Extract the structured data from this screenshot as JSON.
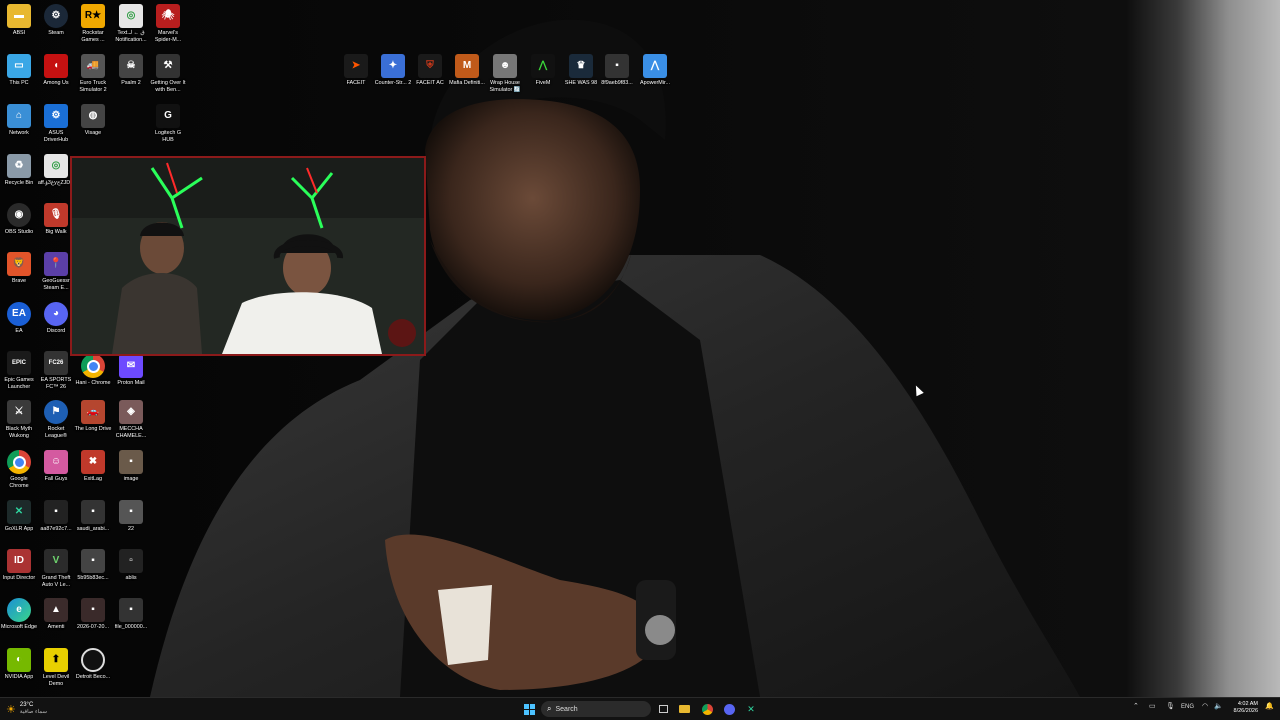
{
  "desktop_icons_col1": [
    {
      "label": "ABSI",
      "icon": "folder-icon",
      "color": "#e8b830"
    },
    {
      "label": "This PC",
      "icon": "monitor-icon",
      "color": "#3aa7e6"
    },
    {
      "label": "Network",
      "icon": "network-icon",
      "color": "#3a8fd6"
    },
    {
      "label": "Recycle Bin",
      "icon": "recycle-bin-icon",
      "color": "#8a9aa8"
    },
    {
      "label": "OBS Studio",
      "icon": "obs-icon",
      "color": "#2a2a2a"
    },
    {
      "label": "Brave",
      "icon": "brave-icon",
      "color": "#e2542a"
    },
    {
      "label": "EA",
      "icon": "ea-icon",
      "color": "#1a5fd6"
    },
    {
      "label": "Epic Games Launcher",
      "icon": "epic-games-icon",
      "color": "#1a1a1a"
    },
    {
      "label": "Black Myth Wukong",
      "icon": "black-myth-icon",
      "color": "#3a3a3a"
    },
    {
      "label": "Google Chrome",
      "icon": "chrome-icon",
      "color": "#2f9e44"
    },
    {
      "label": "GoXLR App",
      "icon": "goxlr-icon",
      "color": "#1d2a2a"
    },
    {
      "label": "Input Director",
      "icon": "input-director-icon",
      "color": "#a33"
    },
    {
      "label": "Microsoft Edge",
      "icon": "edge-icon",
      "color": "#1a8fd6"
    },
    {
      "label": "NVIDIA App",
      "icon": "nvidia-icon",
      "color": "#76b900"
    }
  ],
  "desktop_icons_col2": [
    {
      "label": "Steam",
      "icon": "steam-icon",
      "color": "#1b2838"
    },
    {
      "label": "Among Us",
      "icon": "among-us-icon",
      "color": "#c51111"
    },
    {
      "label": "ASUS DriverHub",
      "icon": "asus-icon",
      "color": "#1a6fd6"
    },
    {
      "label": "aff.غ3ؤyجZJDD",
      "icon": "chrome-shortcut-icon",
      "color": "#2f9e44"
    },
    {
      "label": "Big Walk",
      "icon": "big-walk-icon",
      "color": "#c0392b"
    },
    {
      "label": "GeoGuessr Steam E...",
      "icon": "geoguessr-icon",
      "color": "#5b3fa8"
    },
    {
      "label": "Discord",
      "icon": "discord-icon",
      "color": "#5865f2"
    },
    {
      "label": "EA SPORTS FC™ 26",
      "icon": "ea-fc-icon",
      "color": "#333"
    },
    {
      "label": "Rocket League®",
      "icon": "rocket-league-icon",
      "color": "#1e5fb4"
    },
    {
      "label": "Fall Guys",
      "icon": "fall-guys-icon",
      "color": "#d45aa0"
    },
    {
      "label": "aa87e92c7...",
      "icon": "image-file-icon",
      "color": "#222"
    },
    {
      "label": "Grand Theft Auto V Le...",
      "icon": "gta-icon",
      "color": "#2b2b2b"
    },
    {
      "label": "Amenti",
      "icon": "amenti-icon",
      "color": "#3b2b2b"
    },
    {
      "label": "Level Devil Demo",
      "icon": "level-devil-icon",
      "color": "#e8d000"
    }
  ],
  "desktop_icons_col3": [
    {
      "label": "Rockstar Games ...",
      "icon": "rockstar-icon",
      "color": "#f0a800"
    },
    {
      "label": "Euro Truck Simulator 2",
      "icon": "euro-truck-icon",
      "color": "#555"
    },
    {
      "label": "Visage",
      "icon": "visage-icon",
      "color": "#444"
    },
    {
      "label": "Hani - Chrome",
      "icon": "chrome-profile-icon",
      "color": "#2f9e44"
    },
    {
      "label": "The Long Drive",
      "icon": "long-drive-icon",
      "color": "#b5462f"
    },
    {
      "label": "ExitLag",
      "icon": "exitlag-icon",
      "color": "#c0392b"
    },
    {
      "label": "saudi_arabi...",
      "icon": "image-file-icon",
      "color": "#333"
    },
    {
      "label": "5b95b83ec...",
      "icon": "image-file-icon",
      "color": "#444"
    },
    {
      "label": "2026-07-20...",
      "icon": "image-file-icon",
      "color": "#3a2a2a"
    },
    {
      "label": "Detroit Beco...",
      "icon": "detroit-icon",
      "color": "#111"
    }
  ],
  "desktop_icons_col4": [
    {
      "label": "Marvel's Spider-M...",
      "icon": "spiderman-icon",
      "color": "#b81e1e"
    },
    {
      "label": "Psalm 2",
      "icon": "skull-icon",
      "color": "#444"
    },
    {
      "label": "Getting Over It with Ben...",
      "icon": "getting-over-it-icon",
      "color": "#333"
    },
    {
      "label": "Logitech G HUB",
      "icon": "logitech-icon",
      "color": "#111"
    },
    {
      "label": "Text.ق ← لـ Notification...",
      "icon": "chrome-shortcut-icon",
      "color": "#2f9e44"
    },
    {
      "label": "Proton Mail",
      "icon": "proton-mail-icon",
      "color": "#6d4aff"
    },
    {
      "label": "MECCHA CHAMELE...",
      "icon": "meccha-icon",
      "color": "#7a5a5a"
    },
    {
      "label": "image",
      "icon": "image-file-icon",
      "color": "#6a5a4a"
    },
    {
      "label": "22",
      "icon": "image-file-icon",
      "color": "#555"
    },
    {
      "label": "ablis",
      "icon": "file-icon",
      "color": "#222"
    },
    {
      "label": "file_000000...",
      "icon": "image-file-icon",
      "color": "#333"
    }
  ],
  "top_row_icons": [
    {
      "label": "FACEIT",
      "icon": "faceit-icon",
      "color": "#ff5500"
    },
    {
      "label": "Counter-Str... 2",
      "icon": "cs2-icon",
      "color": "#3a6fd6"
    },
    {
      "label": "FACEIT AC",
      "icon": "faceit-ac-icon",
      "color": "#d13a1a"
    },
    {
      "label": "Mafia Definiti...",
      "icon": "mafia-icon",
      "color": "#c05a1a"
    },
    {
      "label": "Wrap House Simulator 🔄",
      "icon": "wrap-house-icon",
      "color": "#777"
    },
    {
      "label": "FiveM",
      "icon": "fivem-icon",
      "color": "#111"
    },
    {
      "label": "SHE WAS 98",
      "icon": "she-was-98-icon",
      "color": "#1a2a3a"
    },
    {
      "label": "8f9aeb9f83...",
      "icon": "image-file-icon",
      "color": "#333"
    },
    {
      "label": "ApowerMir...",
      "icon": "apowermirror-icon",
      "color": "#3a8fe6"
    }
  ],
  "taskbar": {
    "weather_temp": "23°C",
    "weather_desc": "سماء صافية",
    "search_label": "Search",
    "lang": "ENG",
    "time": "4:02 AM",
    "date": "8/26/2026"
  }
}
